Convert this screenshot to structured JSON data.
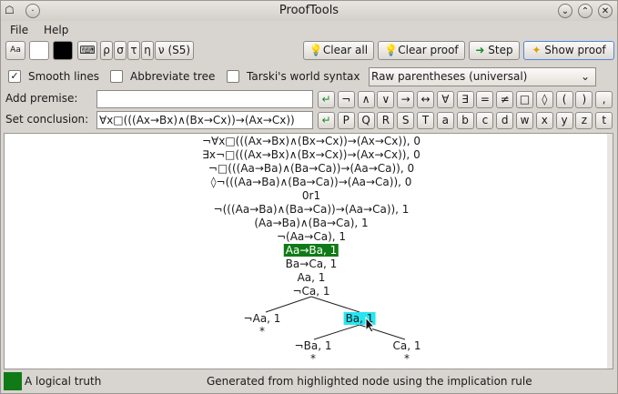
{
  "window": {
    "title": "ProofTools"
  },
  "menu": {
    "file": "File",
    "help": "Help"
  },
  "toolbar": {
    "font_btn": "Aa",
    "sym_keys": [
      "ρ",
      "σ",
      "τ",
      "η",
      "ν (S5)"
    ],
    "clear_all": "Clear all",
    "clear_proof": "Clear proof",
    "step": "Step",
    "show_proof": "Show proof"
  },
  "options": {
    "smooth_lines": "Smooth lines",
    "abbreviate_tree": "Abbreviate tree",
    "tarski": "Tarski's world syntax",
    "parentheses_select": "Raw parentheses (universal)"
  },
  "premise": {
    "label": "Add premise:",
    "value": ""
  },
  "conclusion": {
    "label": "Set conclusion:",
    "value": "∀x□(((Ax→Bx)∧(Bx→Cx))→(Ax→Cx))"
  },
  "symbols_row1": [
    "↵",
    "¬",
    "∧",
    "∨",
    "→",
    "↔",
    "∀",
    "∃",
    "=",
    "≠",
    "□",
    "◊",
    "(",
    ")",
    ","
  ],
  "symbols_row2": [
    "↵",
    "P",
    "Q",
    "R",
    "S",
    "T",
    "a",
    "b",
    "c",
    "d",
    "w",
    "x",
    "y",
    "z",
    "t"
  ],
  "tree": {
    "lines": [
      "¬∀x□(((Ax→Bx)∧(Bx→Cx))→(Ax→Cx)), 0",
      "∃x¬□(((Ax→Bx)∧(Bx→Cx))→(Ax→Cx)), 0",
      "¬□(((Aa→Ba)∧(Ba→Ca))→(Aa→Ca)), 0",
      "◊¬(((Aa→Ba)∧(Ba→Ca))→(Aa→Ca)), 0",
      "0r1",
      "¬(((Aa→Ba)∧(Ba→Ca))→(Aa→Ca)), 1",
      "(Aa→Ba)∧(Ba→Ca), 1",
      "¬(Aa→Ca), 1",
      "Aa→Ba, 1",
      "Ba→Ca, 1",
      "Aa, 1",
      "¬Ca, 1"
    ],
    "left_branch": "¬Aa, 1",
    "right_branch": "Ba, 1",
    "left_sub": "¬Ba, 1",
    "right_sub": "Ca, 1",
    "closed_mark": "*"
  },
  "status": {
    "legend": "A logical truth",
    "message": "Generated from highlighted node using the implication rule"
  },
  "colors": {
    "highlight_green": "#0f7a16",
    "highlight_cyan": "#27e6f0"
  }
}
